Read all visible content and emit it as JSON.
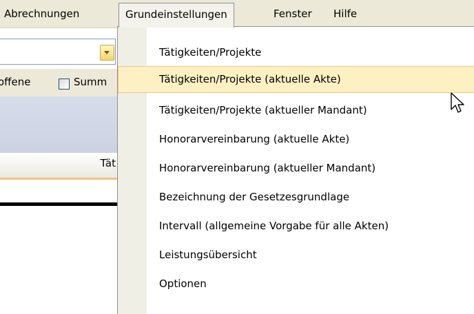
{
  "menubar": {
    "items": [
      {
        "label": "Abrechnungen"
      },
      {
        "label": "Grundeinstellungen"
      },
      {
        "label": "Fenster"
      },
      {
        "label": "Hilfe"
      }
    ]
  },
  "background": {
    "options_text_left": "offene",
    "options_text_right": "Summ",
    "column_header": "Tät"
  },
  "dropdown": {
    "items": [
      {
        "label": "Tätigkeiten/Projekte"
      },
      {
        "label": "Tätigkeiten/Projekte (aktuelle Akte)"
      },
      {
        "label": "Tätigkeiten/Projekte (aktueller Mandant)"
      },
      {
        "label": "Honorarvereinbarung (aktuelle Akte)"
      },
      {
        "label": "Honorarvereinbarung (aktueller Mandant)"
      },
      {
        "label": "Bezeichnung der Gesetzesgrundlage"
      },
      {
        "label": "Intervall (allgemeine Vorgabe für alle Akten)"
      },
      {
        "label": "Leistungsübersicht"
      },
      {
        "label": "Optionen"
      }
    ],
    "highlighted_index": 1
  },
  "colors": {
    "menubar_bg": "#ece9d8",
    "highlight_bg": "#fdf1c4",
    "highlight_border": "#f0c57a",
    "gutter_bg": "#f0efe6"
  }
}
